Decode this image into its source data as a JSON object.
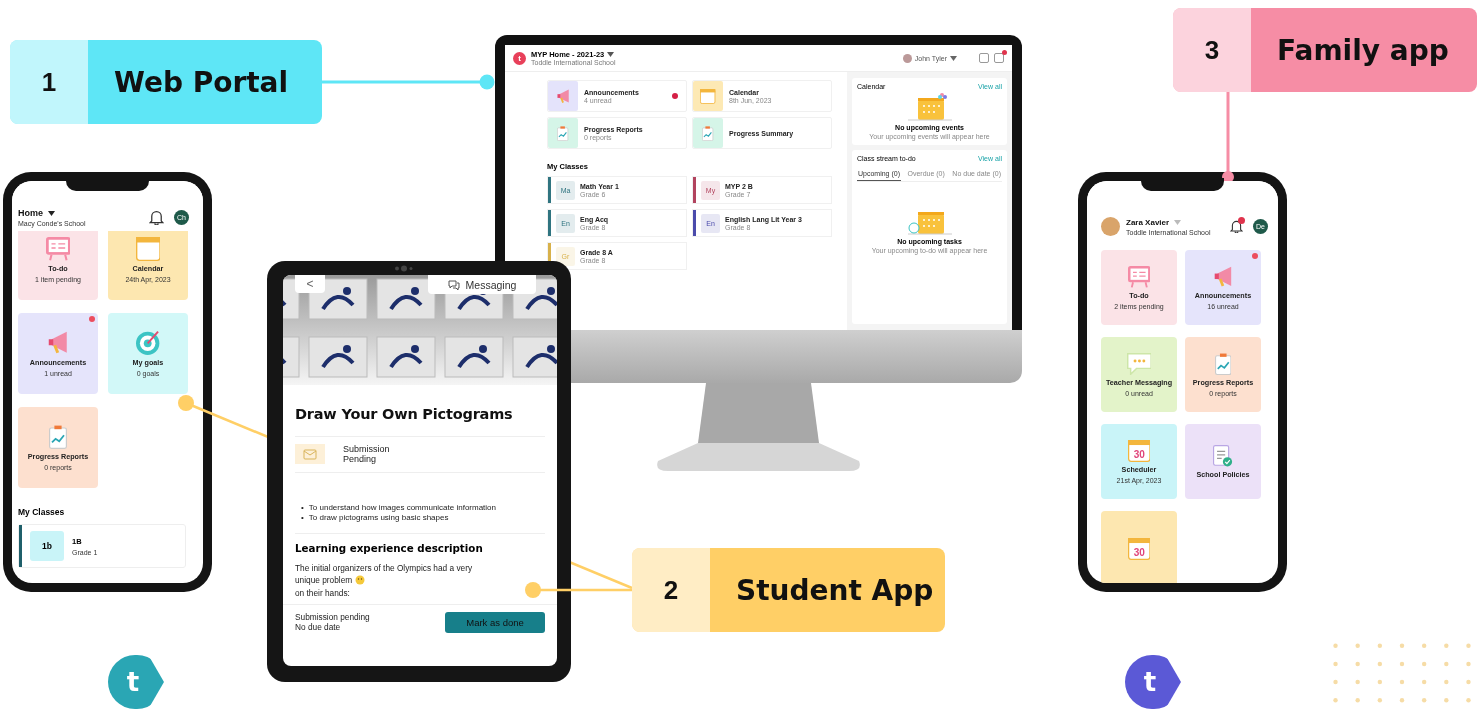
{
  "callouts": [
    {
      "number": "1",
      "title": "Web Portal",
      "color": "#5ee6f6"
    },
    {
      "number": "2",
      "title": "Student App",
      "color": "#ffcf66"
    },
    {
      "number": "3",
      "title": "Family app",
      "color": "#f68da5"
    }
  ],
  "web_portal": {
    "header": {
      "logo_letter": "t",
      "title": "MYP Home - 2021-23",
      "subtitle": "Toddle International School",
      "user": "John Tyler",
      "notification_badge": true
    },
    "tiles": [
      {
        "kind": "announcement",
        "title": "Announcements",
        "subtitle": "4 unread",
        "color": "#e4e3fb",
        "badge": true
      },
      {
        "kind": "calendar",
        "title": "Calendar",
        "subtitle": "8th Jun, 2023",
        "color": "#fde9b4",
        "badge": false
      },
      {
        "kind": "report",
        "title": "Progress Reports",
        "subtitle": "0 reports",
        "color": "#d5f5e8",
        "badge": false
      },
      {
        "kind": "report",
        "title": "Progress Summary",
        "color": "#d5f5e8",
        "badge": false
      }
    ],
    "classes_heading": "My Classes",
    "classes": [
      {
        "initials": "Ma",
        "name": "Math Year 1",
        "grade": "Grade 6",
        "color": "#2f7480"
      },
      {
        "initials": "My",
        "name": "MYP 2 B",
        "grade": "Grade 7",
        "color": "#b2435e"
      },
      {
        "initials": "En",
        "name": "Eng Acq",
        "grade": "Grade 8",
        "color": "#2f7480"
      },
      {
        "initials": "En",
        "name": "English Lang Lit Year 3",
        "grade": "Grade 8",
        "color": "#4b4bab"
      },
      {
        "initials": "Gr",
        "name": "Grade 8 A",
        "grade": "Grade 8",
        "color": "#d8b14a"
      }
    ],
    "calendar_panel": {
      "title": "Calendar",
      "link": "View all",
      "empty_title": "No upcoming events",
      "empty_text": "Your upcoming events will appear here"
    },
    "todo_panel": {
      "title": "Class stream to-do",
      "link": "View all",
      "tabs": [
        {
          "label": "Upcoming (0)",
          "selected": true
        },
        {
          "label": "Overdue (0)",
          "selected": false
        },
        {
          "label": "No due date (0)",
          "selected": false
        }
      ],
      "empty_title": "No upcoming tasks",
      "empty_text": "Your upcoming to-do will appear here"
    }
  },
  "student_phone": {
    "header": {
      "title": "Home",
      "subtitle": "Macy Conde's School",
      "avatar": "Ch",
      "profile_photo": false,
      "bell_badge": false
    },
    "tiles": [
      {
        "kind": "todo",
        "title": "To-do",
        "subtitle": "1 item pending",
        "color": "#fbe3e7",
        "badge": false
      },
      {
        "kind": "calendar",
        "title": "Calendar",
        "subtitle": "24th Apr, 2023",
        "color": "#fde7b0",
        "badge": false
      },
      {
        "kind": "announcement",
        "title": "Announcements",
        "subtitle": "1 unread",
        "color": "#e5e4fb",
        "badge": true
      },
      {
        "kind": "goals",
        "title": "My goals",
        "subtitle": "0 goals",
        "color": "#d2f8f8",
        "badge": false
      },
      {
        "kind": "report",
        "title": "Progress Reports",
        "subtitle": "0 reports",
        "color": "#fde0cf",
        "badge": false
      }
    ],
    "classes_heading": "My Classes",
    "classes": [
      {
        "initials": "1b",
        "name": "1B",
        "grade": "Grade 1",
        "color": "#1f5f6a"
      }
    ]
  },
  "tablet": {
    "back": "<",
    "messaging": "Messaging",
    "title": "Draw Your Own Pictograms",
    "status": "Submission Pending",
    "objectives": [
      {
        "bullet": "•",
        "text": "To understand how images communicate information"
      },
      {
        "bullet": "•",
        "text": "To draw pictograms using basic shapes"
      }
    ],
    "description_heading": "Learning experience description",
    "description_lines": [
      "The initial organizers of the Olympics had a very",
      "unique problem"
    ],
    "description_end": "on their hands:",
    "footer_status": "Submission pending",
    "footer_due": "No due date",
    "action": "Mark as done"
  },
  "family_phone": {
    "header": {
      "title": "Zara Xavier",
      "subtitle": "Toddle International School",
      "avatar": "De",
      "profile_photo": true,
      "bell_badge": true
    },
    "tiles": [
      {
        "kind": "todo",
        "title": "To-do",
        "subtitle": "2 items pending",
        "color": "#fbe3e7",
        "badge": false
      },
      {
        "kind": "announcement",
        "title": "Announcements",
        "subtitle": "16 unread",
        "color": "#e5e4fb",
        "badge": true
      },
      {
        "kind": "message",
        "title": "Teacher Messaging",
        "subtitle": "0 unread",
        "color": "#e3f3c9",
        "badge": false
      },
      {
        "kind": "report",
        "title": "Progress Reports",
        "subtitle": "0 reports",
        "color": "#fde0cf",
        "badge": false
      },
      {
        "kind": "calendar",
        "title": "Scheduler",
        "subtitle": "21st Apr, 2023",
        "color": "#c9f4f8",
        "badge": false,
        "icon_text": "30"
      },
      {
        "kind": "policy",
        "title": "School Policies",
        "color": "#ece1f8",
        "badge": false
      },
      {
        "kind": "calendar",
        "color": "#fde7b0",
        "badge": false,
        "icon_text": "30"
      }
    ]
  },
  "logos": [
    {
      "letter": "t",
      "color": "#2aa6b4"
    },
    {
      "letter": "t",
      "color": "#5b59d6"
    }
  ]
}
